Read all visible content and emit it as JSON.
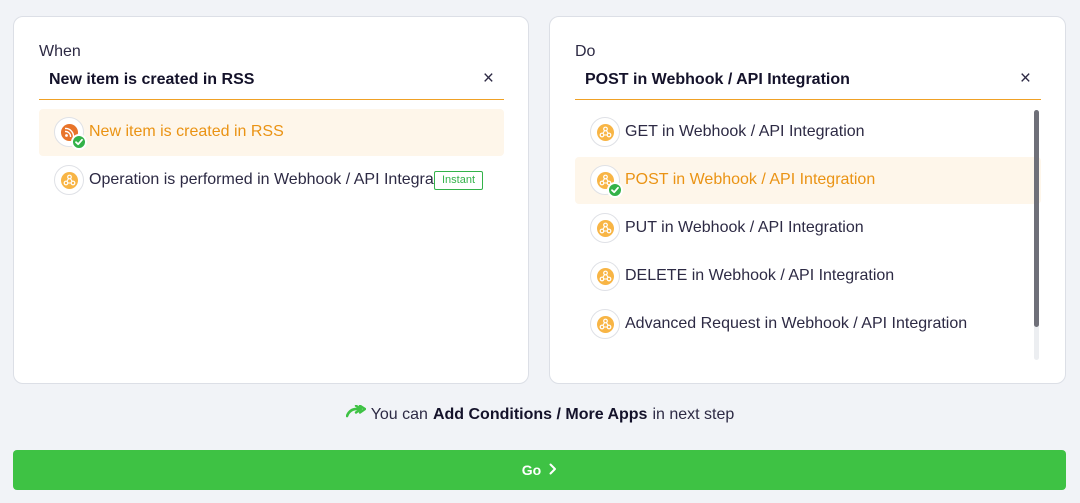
{
  "when_panel": {
    "label": "When",
    "selected": "New item is created in RSS",
    "clear_icon": "×",
    "items": [
      {
        "label": "New item is created in RSS",
        "icon": "rss-icon",
        "active": true
      },
      {
        "label": "Operation is performed in Webhook / API Integration",
        "icon": "webhook-icon",
        "active": false,
        "badge": "Instant"
      }
    ]
  },
  "do_panel": {
    "label": "Do",
    "selected": "POST in Webhook / API Integration",
    "clear_icon": "×",
    "items": [
      {
        "label": "GET in Webhook / API Integration",
        "icon": "webhook-icon",
        "active": false
      },
      {
        "label": "POST in Webhook / API Integration",
        "icon": "webhook-icon",
        "active": true
      },
      {
        "label": "PUT in Webhook / API Integration",
        "icon": "webhook-icon",
        "active": false
      },
      {
        "label": "DELETE in Webhook / API Integration",
        "icon": "webhook-icon",
        "active": false
      },
      {
        "label": "Advanced Request in Webhook / API Integration",
        "icon": "webhook-icon",
        "active": false
      }
    ]
  },
  "hint": {
    "prefix": "You can",
    "bold": "Add Conditions / More Apps",
    "suffix": "in next step",
    "icon": "arrow-forward-icon"
  },
  "go_button": {
    "label": "Go",
    "icon": "chevron-right-icon"
  },
  "colors": {
    "accent": "#f0a125",
    "active_text": "#ea9314",
    "active_bg": "#fef6ea",
    "success": "#33b249",
    "go_button": "#3ec244",
    "rss": "#e8742a",
    "webhook": "#f8b545"
  }
}
